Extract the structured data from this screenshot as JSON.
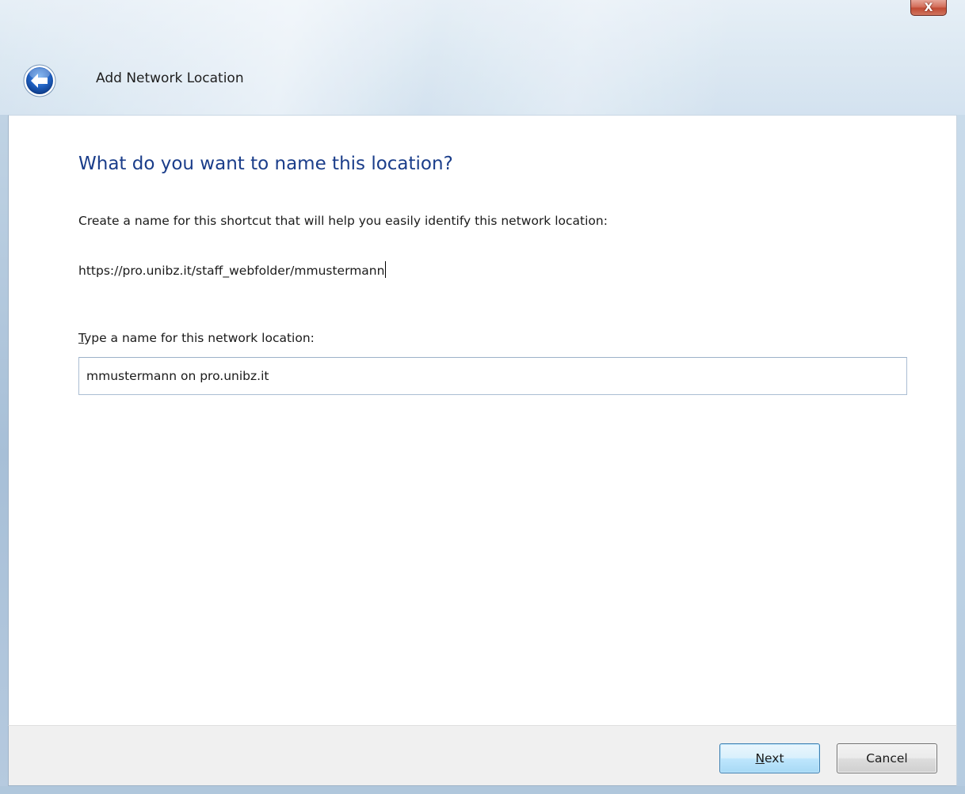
{
  "window": {
    "title": "Add Network Location",
    "close_glyph": "X"
  },
  "page": {
    "heading": "What do you want to name this location?",
    "description": "Create a name for this shortcut that will help you easily identify this network location:",
    "address": "https://pro.unibz.it/staff_webfolder/mmustermann"
  },
  "name_field": {
    "label_mnemonic": "T",
    "label_rest": "ype a name for this network location:",
    "value": "mmustermann on pro.unibz.it"
  },
  "buttons": {
    "next_mnemonic": "N",
    "next_rest": "ext",
    "cancel": "Cancel"
  },
  "colors": {
    "heading": "#1a3d8a",
    "accent_blue": "#1f5fbf",
    "close_red": "#c04a34"
  },
  "icons": {
    "back": "back-arrow-icon",
    "close": "close-icon"
  }
}
